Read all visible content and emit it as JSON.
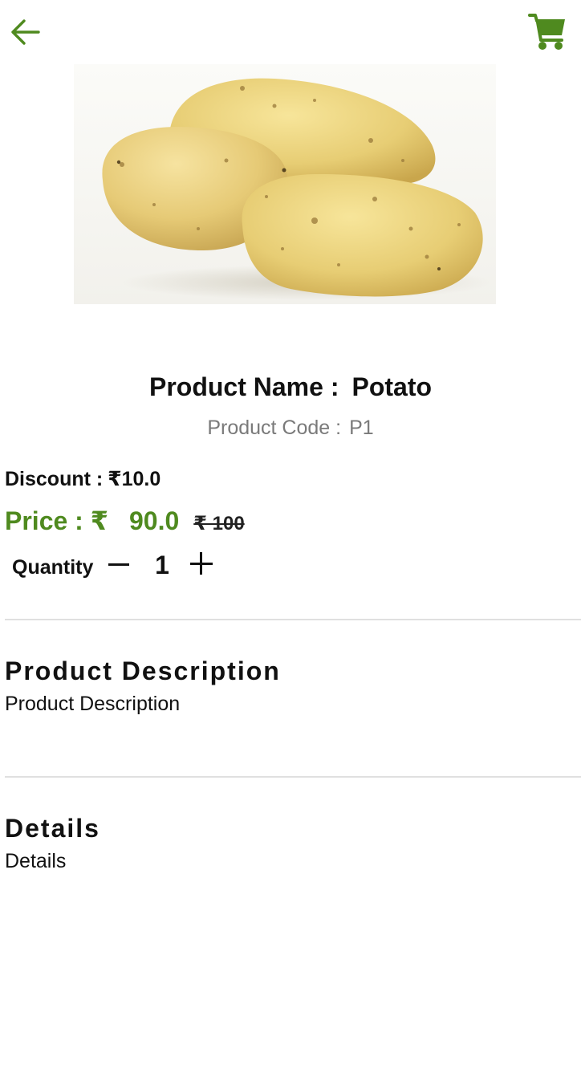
{
  "header": {
    "back_icon": "back-arrow-icon",
    "cart_icon": "shopping-cart-icon",
    "accent_color": "#4f8a1f"
  },
  "product": {
    "image_icon": "potato-image",
    "name_label": "Product Name :",
    "name": "Potato",
    "code_label": "Product Code :",
    "code": "P1",
    "discount_label": "Discount :",
    "discount": "₹10.0",
    "price_label": "Price : ₹",
    "price": "90.0",
    "original_price": "₹ 100"
  },
  "quantity": {
    "label": "Quantity",
    "value": "1"
  },
  "sections": {
    "description_title": "Product Description",
    "description_body": "Product Description",
    "details_title": "Details",
    "details_body": "Details"
  }
}
